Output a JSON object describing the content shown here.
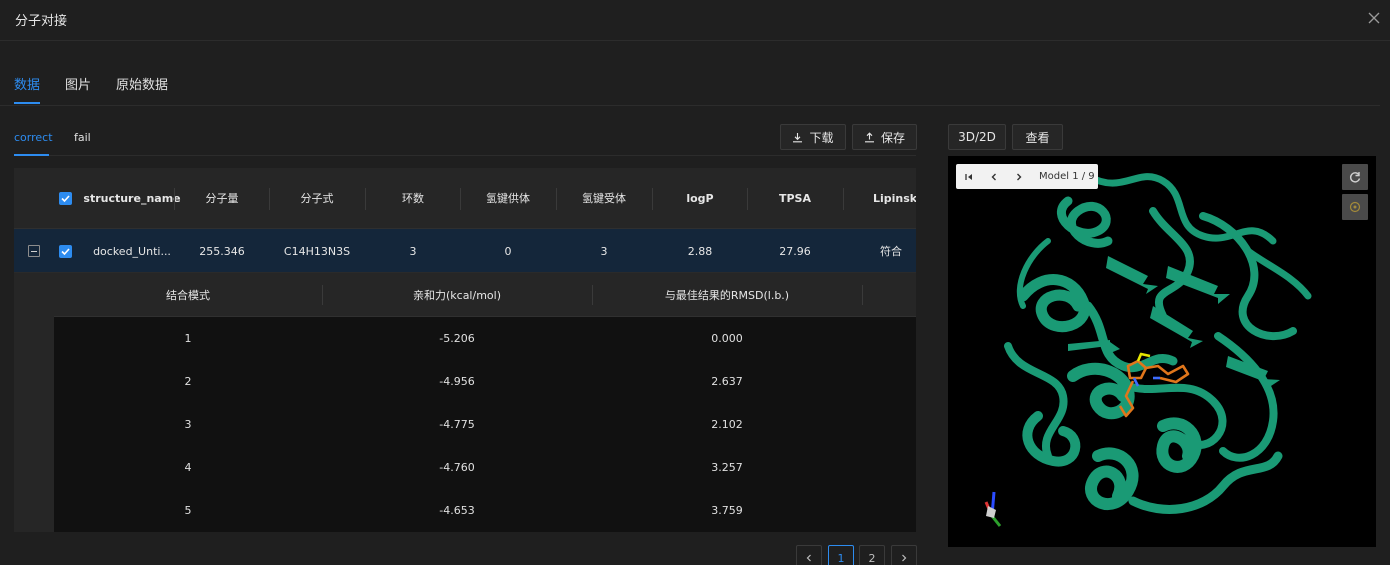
{
  "dialog": {
    "title": "分子对接"
  },
  "main_tabs": [
    {
      "label": "数据",
      "active": true
    },
    {
      "label": "图片",
      "active": false
    },
    {
      "label": "原始数据",
      "active": false
    }
  ],
  "sub_tabs": [
    {
      "label": "correct",
      "active": true
    },
    {
      "label": "fail",
      "active": false
    }
  ],
  "toolbar": {
    "download_label": "下载",
    "save_label": "保存"
  },
  "viewer_toolbar": {
    "mode_label": "3D/2D",
    "view_label": "查看"
  },
  "table": {
    "columns": [
      "structure_name",
      "分子量",
      "分子式",
      "环数",
      "氢键供体",
      "氢键受体",
      "logP",
      "TPSA",
      "Lipinski"
    ],
    "row": {
      "structure_name": "docked_Unti...",
      "mw": "255.346",
      "formula": "C14H13N3S",
      "rings": "3",
      "hbd": "0",
      "hba": "3",
      "logp": "2.88",
      "tpsa": "27.96",
      "lipinski": "符合"
    },
    "sub_columns": [
      "结合模式",
      "亲和力(kcal/mol)",
      "与最佳结果的RMSD(l.b.)"
    ],
    "sub_rows": [
      {
        "mode": "1",
        "affinity": "-5.206",
        "rmsd": "0.000"
      },
      {
        "mode": "2",
        "affinity": "-4.956",
        "rmsd": "2.637"
      },
      {
        "mode": "3",
        "affinity": "-4.775",
        "rmsd": "2.102"
      },
      {
        "mode": "4",
        "affinity": "-4.760",
        "rmsd": "3.257"
      },
      {
        "mode": "5",
        "affinity": "-4.653",
        "rmsd": "3.759"
      }
    ]
  },
  "pagination": {
    "pages": [
      "1",
      "2"
    ],
    "current": "1"
  },
  "viewer": {
    "model_label": "Model 1 / 9"
  },
  "colors": {
    "accent": "#2d8cf0",
    "protein": "#1a9a75",
    "ligand": "#e0761b",
    "bg": "#1f1f1f"
  },
  "icons": [
    "close-icon",
    "download-icon",
    "upload-icon",
    "skip-first-icon",
    "chevron-left-icon",
    "chevron-right-icon",
    "refresh-icon",
    "target-icon",
    "axes-icon"
  ]
}
